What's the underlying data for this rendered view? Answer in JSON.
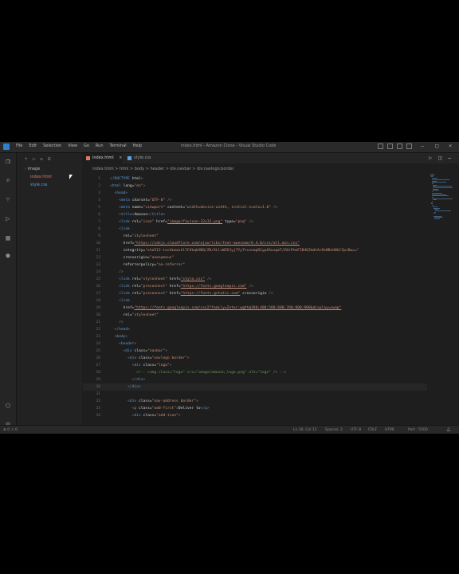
{
  "window": {
    "title": "index.html - Amazon Clone - Visual Studio Code",
    "menu": [
      "File",
      "Edit",
      "Selection",
      "View",
      "Go",
      "Run",
      "Terminal",
      "Help"
    ]
  },
  "explorer": {
    "items": [
      {
        "label": "image",
        "kind": "folder"
      },
      {
        "label": "index.html",
        "kind": "html"
      },
      {
        "label": "style.css",
        "kind": "css"
      }
    ]
  },
  "tabs": [
    {
      "label": "index.html",
      "active": true
    },
    {
      "label": "style.css",
      "active": false
    }
  ],
  "breadcrumb": "index.html > html > body > header > div.navbar > div.navlogo.border",
  "code": {
    "current_line": 30,
    "lines": [
      {
        "n": "1",
        "text": "<!DOCTYPE html>"
      },
      {
        "n": "2",
        "text": "<html lang=\"en\">"
      },
      {
        "n": "3",
        "text": "  <head>"
      },
      {
        "n": "4",
        "text": "    <meta charset=\"UTF-8\" />"
      },
      {
        "n": "5",
        "text": "    <meta name=\"viewport\" content=\"width=device-width, initial-scale=1.0\" />"
      },
      {
        "n": "6",
        "text": "    <title>Amazon</title>"
      },
      {
        "n": "7",
        "text": "    <link rel=\"icon\" href=\"image/favicon-32x32.png\" type=\"png\" />"
      },
      {
        "n": "8",
        "text": "    <link"
      },
      {
        "n": "9",
        "text": "      rel=\"stylesheet\""
      },
      {
        "n": "10",
        "text": "      href=\"https://cdnjs.cloudflare.com/ajax/libs/font-awesome/6.4.0/css/all.min.css\""
      },
      {
        "n": "11",
        "text": "      integrity=\"sha512-iecdLmaskl7CVkqkXNQ/ZH/XLlvWZOJyj7Yy7tcenmpD1ypASozpmT/E0iPtmFIB46ZmdtAc9eNBvH0H/ZpiBw==\""
      },
      {
        "n": "12",
        "text": "      crossorigin=\"anonymous\""
      },
      {
        "n": "13",
        "text": "      referrerpolicy=\"no-referrer\""
      },
      {
        "n": "14",
        "text": "    />"
      },
      {
        "n": "15",
        "text": "    <link rel=\"stylesheet\" href=\"style.css\" />"
      },
      {
        "n": "16",
        "text": "    <link rel=\"preconnect\" href=\"https://fonts.googleapis.com\" />"
      },
      {
        "n": "17",
        "text": "    <link rel=\"preconnect\" href=\"https://fonts.gstatic.com\" crossorigin />"
      },
      {
        "n": "18",
        "text": "    <link"
      },
      {
        "n": "19",
        "text": "      href=\"https://fonts.googleapis.com/css2?family=Inter:wght@300;400;500;600;700;800;900&display=swap\""
      },
      {
        "n": "20",
        "text": "      rel=\"stylesheet\""
      },
      {
        "n": "21",
        "text": "    />"
      },
      {
        "n": "22",
        "text": "  </head>"
      },
      {
        "n": "23",
        "text": "  <body>"
      },
      {
        "n": "24",
        "text": "    <header>"
      },
      {
        "n": "25",
        "text": "      <div class=\"navbar\">"
      },
      {
        "n": "26",
        "text": "        <div class=\"navlogo border\">"
      },
      {
        "n": "27",
        "text": "          <div class=\"logo\">"
      },
      {
        "n": "28",
        "text": "            <!-- <img class=\"logo\" src=\"image/amazon_logo.png\" alt=\"logo\" /> -->"
      },
      {
        "n": "29",
        "text": "          </div>"
      },
      {
        "n": "30",
        "text": "        </div>"
      },
      {
        "n": "31",
        "text": ""
      },
      {
        "n": "32",
        "text": "        <div class=\"nav-address border\">"
      },
      {
        "n": "33",
        "text": "          <p class=\"add-first\">Deliver to</p>"
      },
      {
        "n": "34",
        "text": "          <div class=\"add-icon\">"
      }
    ]
  },
  "status": {
    "left": "⊗ 0 ⚠ 0",
    "position": "Ln 30, Col 11",
    "spaces": "Spaces: 2",
    "encoding": "UTF-8",
    "eol": "CRLF",
    "language": "HTML",
    "port": "Port : 5500"
  },
  "colors": {
    "accent": "#2f7fd1",
    "background": "#1e1e1e",
    "tag": "#569cd6",
    "attr": "#9cdcfe",
    "string": "#ce9178"
  }
}
